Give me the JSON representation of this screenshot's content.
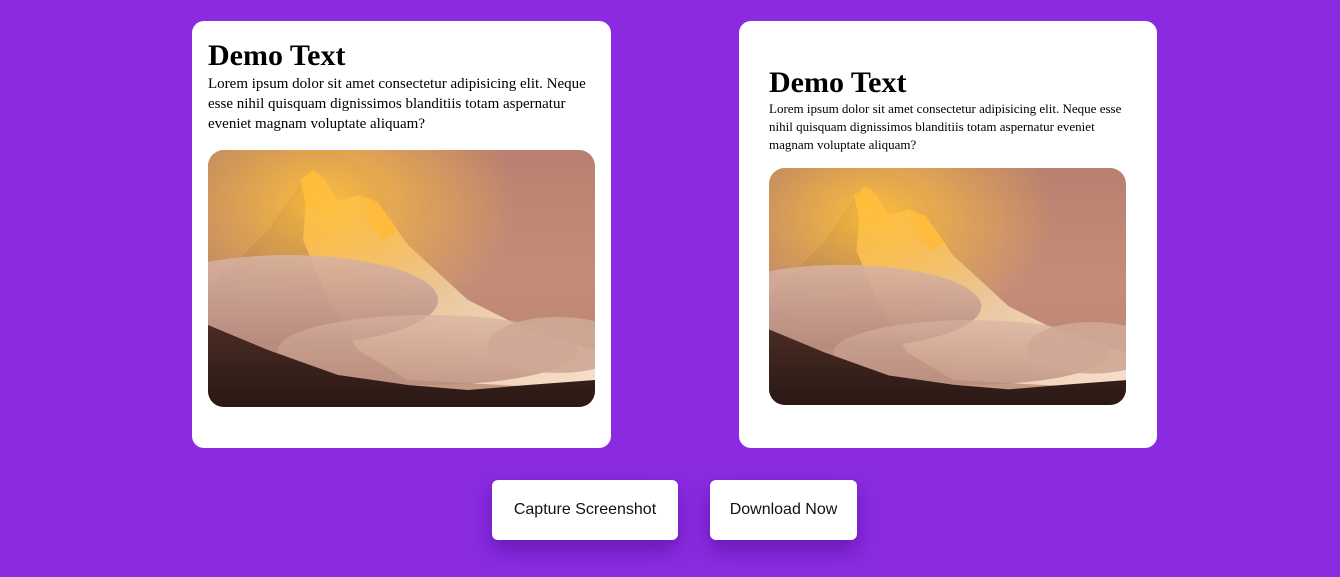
{
  "colors": {
    "background": "#8a2be2",
    "card": "#ffffff"
  },
  "cards": [
    {
      "title": "Demo Text",
      "body": "Lorem ipsum dolor sit amet consectetur adipisicing elit. Neque esse nihil quisquam dignissimos blanditiis totam aspernatur eveniet magnam voluptate aliquam?",
      "image_subject": "mountain-sunset-photo"
    },
    {
      "title": "Demo Text",
      "body": "Lorem ipsum dolor sit amet consectetur adipisicing elit. Neque esse nihil quisquam dignissimos blanditiis totam aspernatur eveniet magnam voluptate aliquam?",
      "image_subject": "mountain-sunset-photo"
    }
  ],
  "buttons": {
    "capture_label": "Capture Screenshot",
    "download_label": "Download Now"
  }
}
